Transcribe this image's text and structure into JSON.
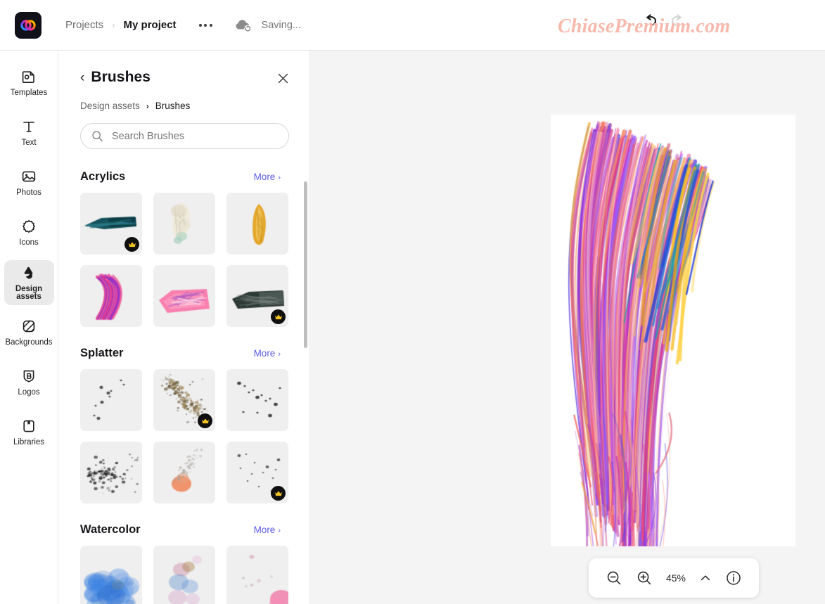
{
  "app": {
    "logo_icon": "adobe-creative-cloud-logo",
    "accent_color": "#5c5ce0",
    "premium_badge_bg": "#101010",
    "premium_badge_color": "#f2c423"
  },
  "topbar": {
    "breadcrumb_root": "Projects",
    "breadcrumb_separator": "›",
    "breadcrumb_current": "My project",
    "more_options_icon": "ellipsis-icon",
    "cloud_icon": "cloud-sync-icon",
    "status_text": "Saving...",
    "undo_icon": "undo-arrow-icon",
    "redo_icon": "redo-arrow-icon",
    "watermark": "ChiasePremium.com"
  },
  "rail": {
    "items": [
      {
        "label": "Templates",
        "icon": "templates-icon",
        "active": false
      },
      {
        "label": "Text",
        "icon": "text-icon",
        "active": false
      },
      {
        "label": "Photos",
        "icon": "photos-icon",
        "active": false
      },
      {
        "label": "Icons",
        "icon": "icons-icon",
        "active": false
      },
      {
        "label": "Design assets",
        "icon": "design-assets-icon",
        "active": true
      },
      {
        "label": "Backgrounds",
        "icon": "backgrounds-icon",
        "active": false
      },
      {
        "label": "Logos",
        "icon": "logos-icon",
        "active": false
      },
      {
        "label": "Libraries",
        "icon": "libraries-icon",
        "active": false
      }
    ]
  },
  "panel": {
    "back_icon": "chevron-left-icon",
    "title": "Brushes",
    "close_icon": "close-icon",
    "breadcrumb_parent": "Design assets",
    "breadcrumb_separator": "›",
    "breadcrumb_current": "Brushes",
    "search": {
      "icon": "search-icon",
      "value": "",
      "placeholder": "Search Brushes"
    },
    "more_label": "More",
    "more_chevron": "›",
    "sections": [
      {
        "title": "Acrylics",
        "tiles": [
          {
            "name": "teal-acrylic-stroke",
            "premium": true,
            "style": "teal-slab"
          },
          {
            "name": "cream-acrylic-stroke",
            "premium": false,
            "style": "cream-wisp"
          },
          {
            "name": "gold-acrylic-stroke",
            "premium": false,
            "style": "gold-blade"
          },
          {
            "name": "pink-purple-acrylic",
            "premium": false,
            "style": "magenta-arc"
          },
          {
            "name": "pink-acrylic-smear",
            "premium": false,
            "style": "pink-smear"
          },
          {
            "name": "black-acrylic-stroke",
            "premium": true,
            "style": "charcoal-slab"
          }
        ]
      },
      {
        "title": "Splatter",
        "tiles": [
          {
            "name": "sparse-splatter",
            "premium": false,
            "style": "splat-sparse"
          },
          {
            "name": "dense-gold-splatter",
            "premium": true,
            "style": "splat-gold"
          },
          {
            "name": "diagonal-splatter",
            "premium": false,
            "style": "splat-diag"
          },
          {
            "name": "cluster-splatter",
            "premium": false,
            "style": "splat-cluster"
          },
          {
            "name": "peach-blob-splatter",
            "premium": false,
            "style": "splat-peach"
          },
          {
            "name": "scattered-splatter",
            "premium": true,
            "style": "splat-scatter"
          }
        ]
      },
      {
        "title": "Watercolor",
        "tiles": [
          {
            "name": "blue-watercolor-wash",
            "premium": false,
            "style": "wc-blue"
          },
          {
            "name": "mixed-watercolor-wash",
            "premium": false,
            "style": "wc-mixed"
          },
          {
            "name": "pink-watercolor-specks",
            "premium": false,
            "style": "wc-pink"
          }
        ]
      }
    ]
  },
  "canvas": {
    "artwork_name": "colorful-paint-brush-stroke",
    "background": "#ffffff"
  },
  "zoombar": {
    "zoom_out_icon": "zoom-out-icon",
    "zoom_in_icon": "zoom-in-icon",
    "zoom_level": "45%",
    "expand_icon": "chevron-up-icon",
    "info_icon": "info-icon"
  }
}
